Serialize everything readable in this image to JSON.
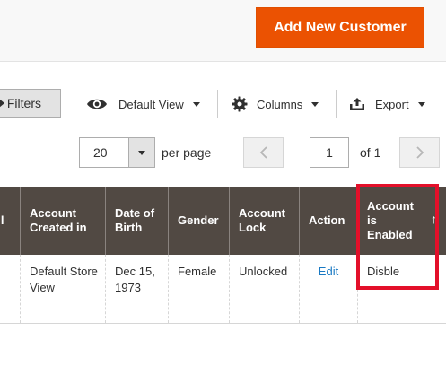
{
  "header": {
    "add_customer_label": "Add New Customer",
    "accent_color": "#eb5202"
  },
  "toolbar": {
    "filters_label": "Filters",
    "view_label": "Default View",
    "columns_label": "Columns",
    "export_label": "Export"
  },
  "pager": {
    "per_page_value": "20",
    "per_page_label": "per page",
    "current_page": "1",
    "of_label": "of 1"
  },
  "grid": {
    "columns": [
      "ail",
      "Account Created in",
      "Date of Birth",
      "Gender",
      "Account Lock",
      "Action",
      "Account is Enabled"
    ],
    "sort_indicator": "↑",
    "rows": [
      {
        "email_partial": "",
        "created_in": "Default Store View",
        "date_of_birth": "Dec 15, 1973",
        "gender": "Female",
        "account_lock": "Unlocked",
        "action": "Edit",
        "account_enabled": "Disble"
      }
    ]
  },
  "highlight_color": "#e3102a"
}
